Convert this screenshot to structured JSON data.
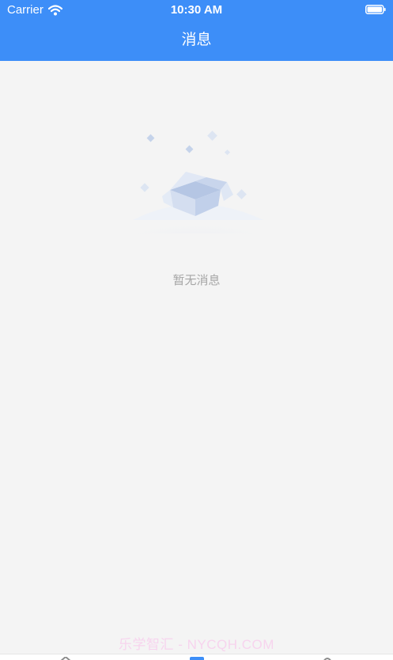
{
  "status_bar": {
    "carrier": "Carrier",
    "time": "10:30 AM",
    "wifi_icon": "wifi-icon",
    "battery_icon": "battery-icon"
  },
  "header": {
    "title": "消息",
    "background_color": "#3d8ef8"
  },
  "empty_state": {
    "illustration_icon": "empty-box-icon",
    "message": "暂无消息"
  },
  "watermark": {
    "text": "乐学智汇 - NYCQH.COM"
  },
  "tab_bar": {
    "icons": [
      "tab-home-icon",
      "tab-message-icon",
      "tab-profile-icon"
    ],
    "active_color": "#3d8ef8"
  }
}
